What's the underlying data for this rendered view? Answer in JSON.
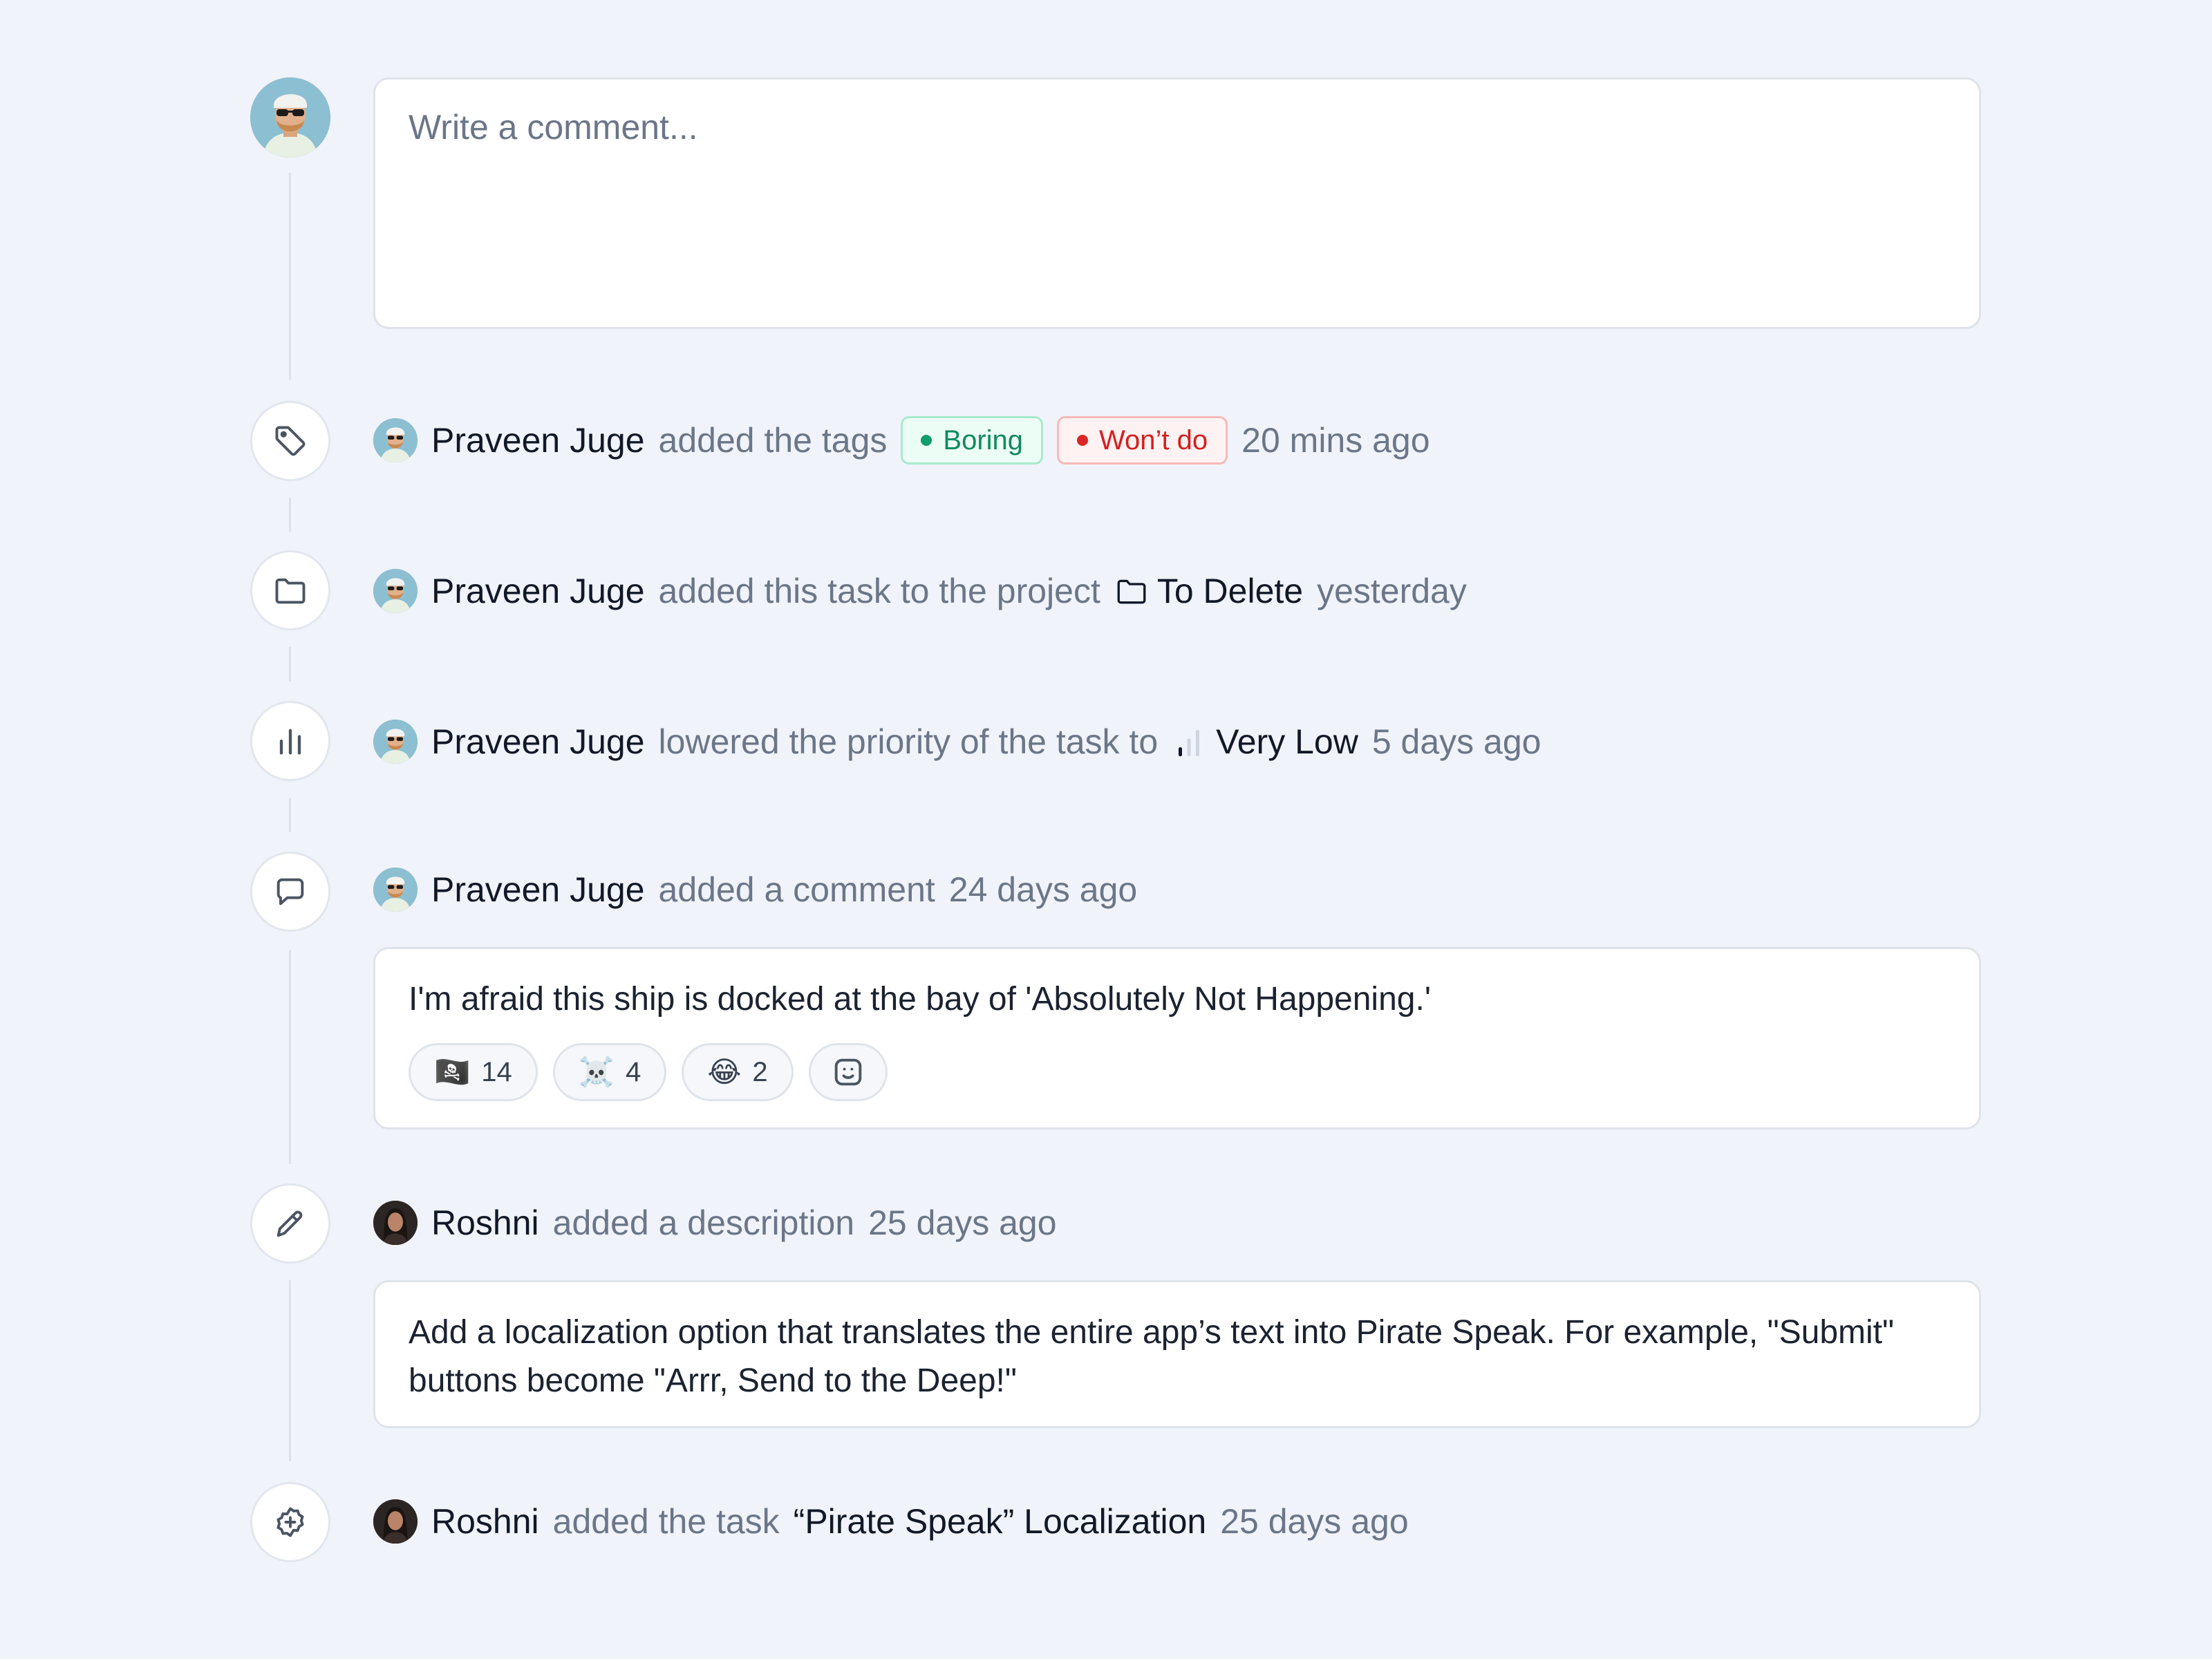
{
  "composer": {
    "placeholder": "Write a comment..."
  },
  "activities": [
    {
      "actor": "Praveen Juge",
      "action": "added the tags",
      "tags": [
        {
          "label": "Boring",
          "color": "#0f8a5f"
        },
        {
          "label": "Won’t do",
          "color": "#d41f1f"
        }
      ],
      "time": "20 mins ago",
      "icon": "tag-icon"
    },
    {
      "actor": "Praveen Juge",
      "action": "added this task to the project",
      "project": "To Delete",
      "time": "yesterday",
      "icon": "folder-icon"
    },
    {
      "actor": "Praveen Juge",
      "action": "lowered the priority of the task to",
      "priority": "Very Low",
      "time": "5 days ago",
      "icon": "bar-chart-icon"
    },
    {
      "actor": "Praveen Juge",
      "action": "added a comment",
      "time": "24 days ago",
      "icon": "comment-icon",
      "comment": "I'm afraid this ship is docked at the bay of 'Absolutely Not Happening.'",
      "reactions": [
        {
          "emoji": "🏴‍☠️",
          "count": "14"
        },
        {
          "emoji": "☠️",
          "count": "4"
        },
        {
          "emoji": "😂",
          "count": "2"
        }
      ]
    },
    {
      "actor": "Roshni",
      "action": "added a description",
      "time": "25 days ago",
      "icon": "pencil-icon",
      "description": "Add a localization option that translates the entire app’s text into Pirate Speak. For example, \"Submit\" buttons become \"Arrr, Send to the Deep!\""
    },
    {
      "actor": "Roshni",
      "action": "added the task",
      "task": "“Pirate Speak” Localization",
      "time": "25 days ago",
      "icon": "plus-badge-icon"
    }
  ]
}
